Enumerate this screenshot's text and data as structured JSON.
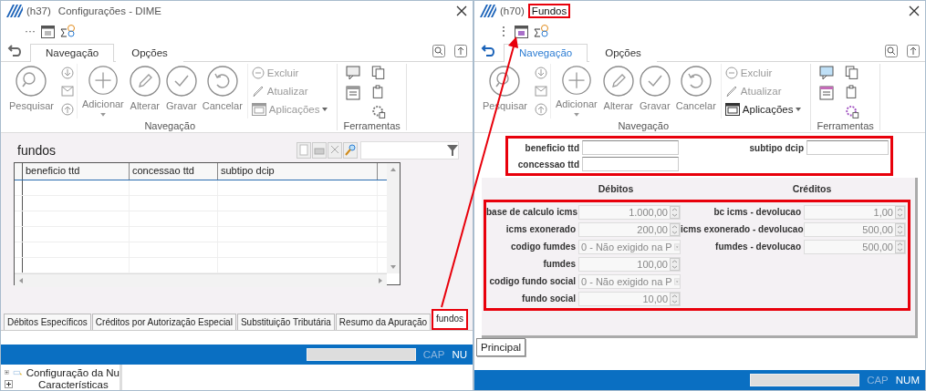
{
  "windows": [
    {
      "active": false,
      "title_code": "(h37)",
      "title": "Configurações - DIME",
      "title_highlighted": false,
      "more_glyph": "···",
      "tabs": [
        {
          "label": "Navegação",
          "selected": true
        },
        {
          "label": "Opções",
          "selected": false
        }
      ],
      "ribbon": {
        "search_button": {
          "label": "Pesquisar",
          "disabled": true
        },
        "edit_buttons": [
          {
            "kind": "add",
            "label": "Adicionar",
            "disabled": true
          },
          {
            "kind": "edit",
            "label": "Alterar",
            "disabled": true
          },
          {
            "kind": "save",
            "label": "Gravar",
            "disabled": true
          },
          {
            "kind": "cancel",
            "label": "Cancelar",
            "disabled": true
          }
        ],
        "actions": [
          {
            "kind": "delete",
            "label": "Excluir",
            "disabled": true
          },
          {
            "kind": "refresh",
            "label": "Atualizar",
            "disabled": true
          },
          {
            "kind": "apps",
            "label": "Aplicações",
            "disabled": true
          }
        ],
        "group_labels": [
          "Navegação",
          "Ferramentas"
        ]
      },
      "content": {
        "kind": "grid",
        "title": "fundos",
        "columns": [
          "beneficio ttd",
          "concessao ttd",
          "subtipo dcip"
        ],
        "tabs": [
          {
            "label": "Débitos Específicos",
            "selected": false,
            "highlighted": false
          },
          {
            "label": "Créditos por Autorização Especial",
            "selected": false,
            "highlighted": false
          },
          {
            "label": "Substituição Tributária",
            "selected": false,
            "highlighted": false
          },
          {
            "label": "Resumo da Apuração",
            "selected": false,
            "highlighted": false
          },
          {
            "label": "fundos",
            "selected": true,
            "highlighted": true
          }
        ]
      },
      "status_bar": {
        "caps": "CAP",
        "num": "NU"
      },
      "tree_items": [
        {
          "label": "Configuração da Nu",
          "expanded": false
        },
        {
          "label": "Características",
          "expanded": false
        }
      ]
    },
    {
      "active": true,
      "title_code": "(h70)",
      "title": "Fundos",
      "title_highlighted": true,
      "more_glyph": "⋮",
      "tabs": [
        {
          "label": "Navegação",
          "selected": true
        },
        {
          "label": "Opções",
          "selected": false
        }
      ],
      "ribbon": {
        "search_button": {
          "label": "Pesquisar",
          "disabled": true
        },
        "edit_buttons": [
          {
            "kind": "add",
            "label": "Adicionar",
            "disabled": true
          },
          {
            "kind": "edit",
            "label": "Alterar",
            "disabled": true
          },
          {
            "kind": "save",
            "label": "Gravar",
            "disabled": true
          },
          {
            "kind": "cancel",
            "label": "Cancelar",
            "disabled": true
          }
        ],
        "actions": [
          {
            "kind": "delete",
            "label": "Excluir",
            "disabled": true
          },
          {
            "kind": "refresh",
            "label": "Atualizar",
            "disabled": true
          },
          {
            "kind": "apps",
            "label": "Aplicações",
            "disabled": false
          }
        ],
        "group_labels": [
          "Navegação",
          "Ferramentas"
        ]
      },
      "content": {
        "kind": "form",
        "top_highlighted": true,
        "top_fields": [
          {
            "label": "beneficio ttd"
          },
          {
            "label": "subtipo dcip"
          },
          {
            "label": "concessao ttd"
          }
        ],
        "debitos_title": "Débitos",
        "creditos_title": "Créditos",
        "values_highlighted": true,
        "debitos": [
          {
            "kind": "spin",
            "label": "base de calculo icms",
            "value": "1.000,00"
          },
          {
            "kind": "spin",
            "label": "icms exonerado",
            "value": "200,00"
          },
          {
            "kind": "combo",
            "label": "codigo fumdes",
            "value": "0 - Não exigido na P"
          },
          {
            "kind": "spin",
            "label": "fumdes",
            "value": "100,00"
          },
          {
            "kind": "combo",
            "label": "codigo fundo social",
            "value": "0 - Não exigido na P"
          },
          {
            "kind": "spin",
            "label": "fundo social",
            "value": "10,00"
          }
        ],
        "creditos": [
          {
            "kind": "spin",
            "label": "bc icms - devolucao",
            "value": "1,00"
          },
          {
            "kind": "spin",
            "label": "icms exonerado - devolucao",
            "value": "500,00"
          },
          {
            "kind": "spin",
            "label": "fumdes - devolucao",
            "value": "500,00"
          }
        ],
        "tabs": [
          {
            "label": "Principal",
            "selected": true,
            "highlighted": false
          }
        ]
      },
      "status_bar": {
        "caps": "CAP",
        "num": "NUM"
      }
    }
  ]
}
